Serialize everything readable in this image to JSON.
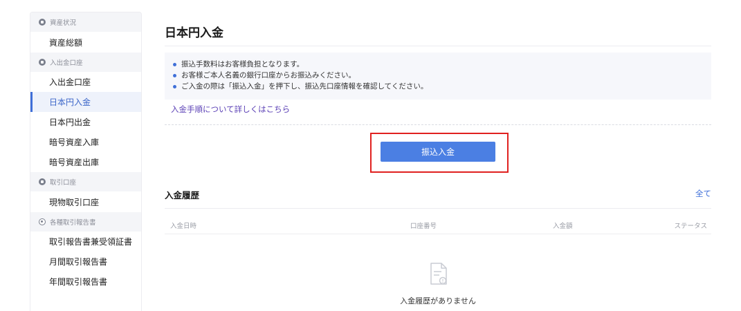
{
  "sidebar": {
    "sections": [
      {
        "label": "資産状況",
        "items": [
          "資産総額"
        ]
      },
      {
        "label": "入出金口座",
        "items": [
          "入出金口座",
          "日本円入金",
          "日本円出金",
          "暗号資産入庫",
          "暗号資産出庫"
        ]
      },
      {
        "label": "取引口座",
        "items": [
          "現物取引口座"
        ]
      },
      {
        "label": "各種取引報告書",
        "items": [
          "取引報告書兼受領証書",
          "月間取引報告書",
          "年間取引報告書"
        ]
      }
    ],
    "active_item": "日本円入金"
  },
  "main": {
    "title": "日本円入金",
    "notices": [
      "振込手数料はお客様負担となります。",
      "お客様ご本人名義の銀行口座からお振込みください。",
      "ご入金の際は「振込入金」を押下し、振込先口座情報を確認してください。"
    ],
    "help_link": "入金手順について詳しくはこちら",
    "transfer_button": "振込入金",
    "history": {
      "title": "入金履歴",
      "all_link": "全て",
      "columns": [
        "入金日時",
        "口座番号",
        "入金額",
        "ステータス"
      ],
      "empty_text": "入金履歴がありません"
    }
  },
  "colors": {
    "accent": "#4b7fe3",
    "link": "#5a3fb5",
    "highlight": "#e0201f",
    "active_bg": "#eef2fb"
  }
}
